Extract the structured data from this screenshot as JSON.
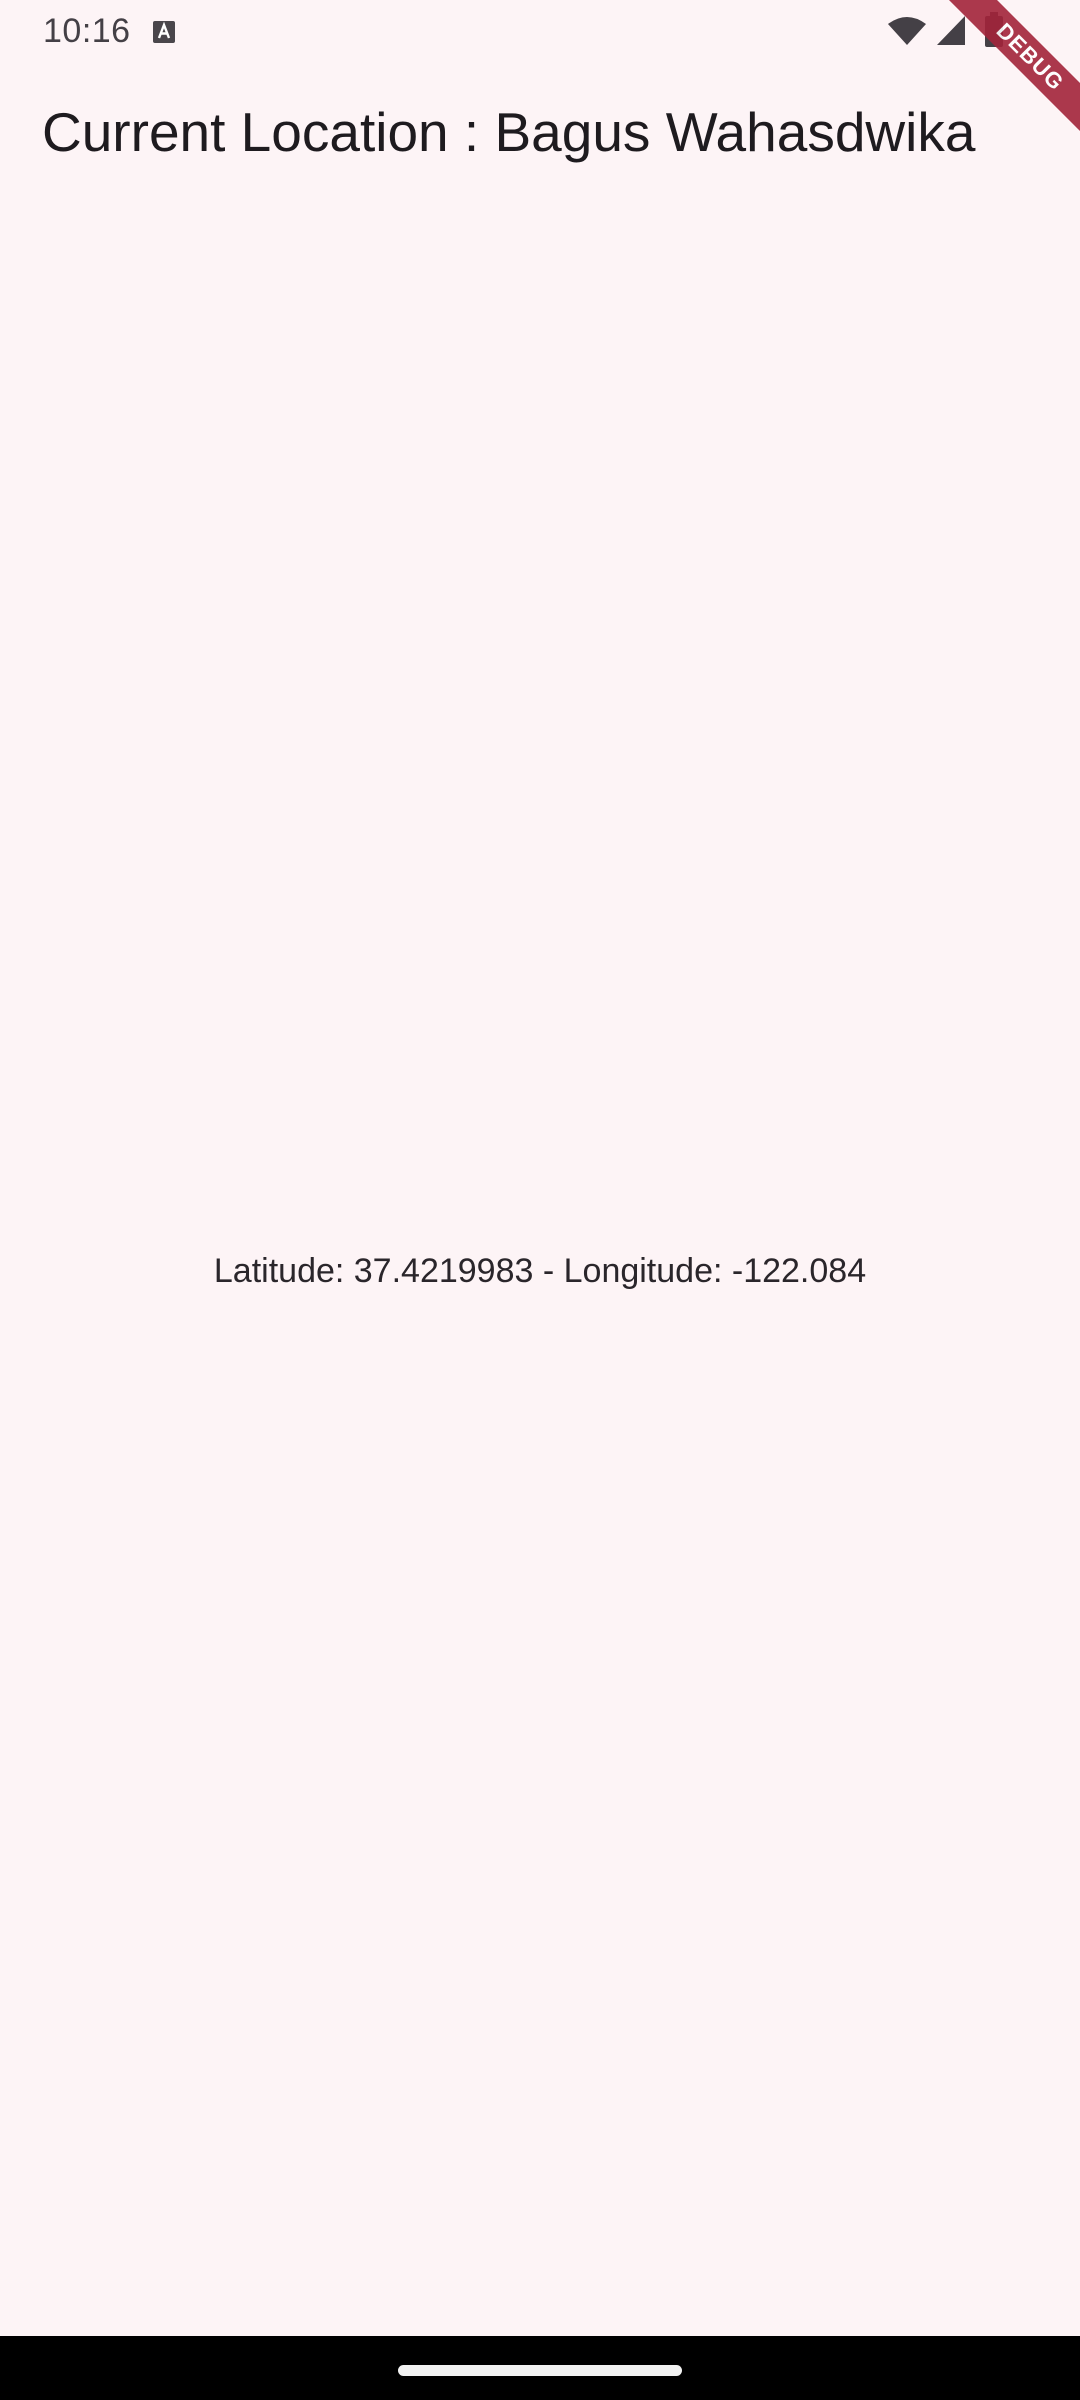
{
  "status_bar": {
    "time": "10:16",
    "icons": [
      "notification-a-icon",
      "wifi-icon",
      "cell-signal-icon",
      "battery-icon"
    ]
  },
  "debug_banner": {
    "label": "DEBUG",
    "color": "#a3243a"
  },
  "app_bar": {
    "title": "Current Location : Bagus Wahasdwika"
  },
  "body": {
    "location_text": "Latitude: 37.4219983 - Longitude: -122.084"
  },
  "colors": {
    "background": "#fdf4f6",
    "text": "#1e1b1f",
    "nav_bar": "#000000"
  }
}
